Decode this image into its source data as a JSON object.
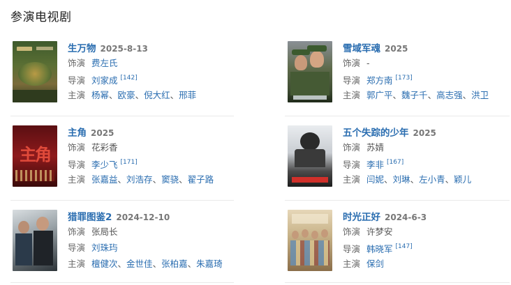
{
  "section": {
    "title": "参演电视剧"
  },
  "works": [
    {
      "title": "生万物",
      "date": "2025-8-13",
      "role_label": "饰演",
      "role": "费左氏",
      "director_label": "导演",
      "directors": [
        "刘家成"
      ],
      "director_ref": "[142]",
      "cast_label": "主演",
      "cast": [
        "杨幂",
        "欧豪",
        "倪大红",
        "邢菲"
      ],
      "poster_icon": "poster-shengwanwu"
    },
    {
      "title": "雪域军魂",
      "date": "2025",
      "role_label": "饰演",
      "role": "-",
      "director_label": "导演",
      "directors": [
        "郑方南"
      ],
      "director_ref": "[173]",
      "cast_label": "主演",
      "cast": [
        "郭广平",
        "魏子千",
        "高志强",
        "洪卫"
      ],
      "poster_icon": "poster-xueyujunhun"
    },
    {
      "title": "主角",
      "date": "2025",
      "role_label": "饰演",
      "role": "花彩香",
      "director_label": "导演",
      "directors": [
        "李少飞"
      ],
      "director_ref": "[171]",
      "cast_label": "主演",
      "cast": [
        "张嘉益",
        "刘浩存",
        "窦骁",
        "翟子路"
      ],
      "poster_icon": "poster-zhujue",
      "poster_text": "主角"
    },
    {
      "title": "五个失踪的少年",
      "date": "2025",
      "role_label": "饰演",
      "role": "苏婧",
      "director_label": "导演",
      "directors": [
        "李非"
      ],
      "director_ref": "[167]",
      "cast_label": "主演",
      "cast": [
        "闫妮",
        "刘琳",
        "左小青",
        "颖儿"
      ],
      "poster_icon": "poster-wugeshizong"
    },
    {
      "title": "猎罪图鉴2",
      "date": "2024-12-10",
      "role_label": "饰演",
      "role": "张局长",
      "director_label": "导演",
      "directors": [
        "刘珠玙"
      ],
      "director_ref": "",
      "cast_label": "主演",
      "cast": [
        "檀健次",
        "金世佳",
        "张柏嘉",
        "朱嘉琦"
      ],
      "poster_icon": "poster-liezuitujian"
    },
    {
      "title": "时光正好",
      "date": "2024-6-3",
      "role_label": "饰演",
      "role": "许梦安",
      "director_label": "导演",
      "directors": [
        "韩晓军"
      ],
      "director_ref": "[147]",
      "cast_label": "主演",
      "cast": [
        "保剑"
      ],
      "poster_icon": "poster-shiguangzhenghao"
    }
  ],
  "sep": "、"
}
